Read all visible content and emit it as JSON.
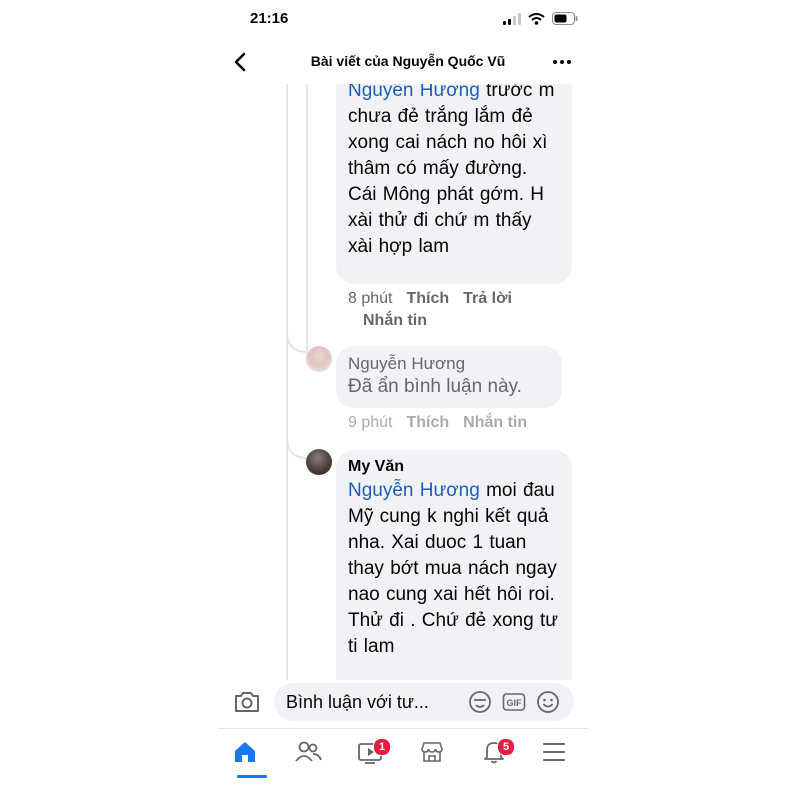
{
  "status_bar": {
    "time": "21:16"
  },
  "header": {
    "title": "Bài viết của Nguyễn Quốc Vũ"
  },
  "comment_top": {
    "mention": "Nguyễn Hương",
    "text": " trước m chưa đẻ trắng lắm đẻ xong cai nách no hôi xì thâm có mấy đường. Cái Mông phát gớm. H xài thử đi chứ m thấy xài hợp lam",
    "time": "8 phút",
    "like": "Thích",
    "reply": "Trả lời",
    "message": "Nhắn tin"
  },
  "comment_hidden": {
    "author": "Nguyễn Hương",
    "text": "Đã ẩn bình luận này.",
    "time": "9 phút",
    "like": "Thích",
    "message": "Nhắn tin"
  },
  "comment_my": {
    "author": "My Văn",
    "mention": "Nguyễn Hương",
    "text": " moi đau Mỹ cung k nghi kết quả nha. Xai duoc 1 tuan thay bớt mua nách ngay nao cung xai hết hôi roi. Thử đi . Chứ đẻ xong tư ti lam"
  },
  "input_bar": {
    "placeholder": "Bình luận với tư..."
  },
  "tab_bar": {
    "video_badge": "1",
    "notifications_badge": "5"
  },
  "colors": {
    "accent": "#1877f2",
    "mention": "#1c5fb8",
    "bubble": "#f0f2f5",
    "badge": "#e41e3f"
  }
}
